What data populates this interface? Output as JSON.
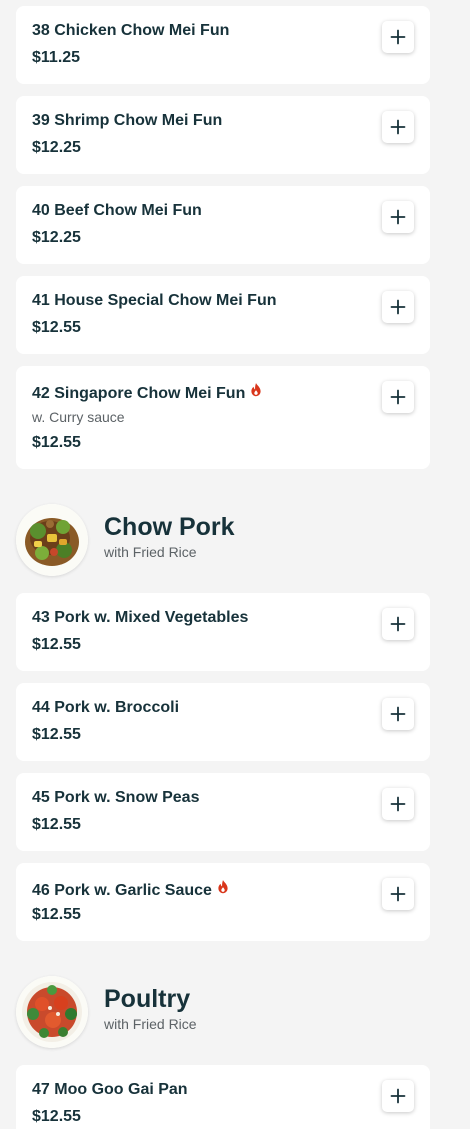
{
  "colors": {
    "text_primary": "#17323a",
    "text_secondary": "#5c6266",
    "spicy": "#d9361b",
    "background": "#f4f4f4",
    "card": "#ffffff"
  },
  "icons": {
    "add": "plus-icon",
    "spicy": "flame-icon"
  },
  "items_top": [
    {
      "name": "38 Chicken Chow Mei Fun",
      "price": "$11.25",
      "spicy": false
    },
    {
      "name": "39 Shrimp Chow Mei Fun",
      "price": "$12.25",
      "spicy": false
    },
    {
      "name": "40 Beef Chow Mei Fun",
      "price": "$12.25",
      "spicy": false
    },
    {
      "name": "41 House Special Chow Mei Fun",
      "price": "$12.55",
      "spicy": false
    },
    {
      "name": "42 Singapore Chow Mei Fun",
      "description": "w. Curry sauce",
      "price": "$12.55",
      "spicy": true
    }
  ],
  "sections": [
    {
      "title": "Chow Pork",
      "subtitle": "with Fried Rice",
      "items": [
        {
          "name": "43 Pork w. Mixed Vegetables",
          "price": "$12.55",
          "spicy": false
        },
        {
          "name": "44 Pork w. Broccoli",
          "price": "$12.55",
          "spicy": false
        },
        {
          "name": "45 Pork w. Snow Peas",
          "price": "$12.55",
          "spicy": false
        },
        {
          "name": "46 Pork w. Garlic Sauce",
          "price": "$12.55",
          "spicy": true
        }
      ]
    },
    {
      "title": "Poultry",
      "subtitle": "with Fried Rice",
      "items": [
        {
          "name": "47 Moo Goo Gai Pan",
          "price": "$12.55",
          "spicy": false
        }
      ]
    }
  ]
}
